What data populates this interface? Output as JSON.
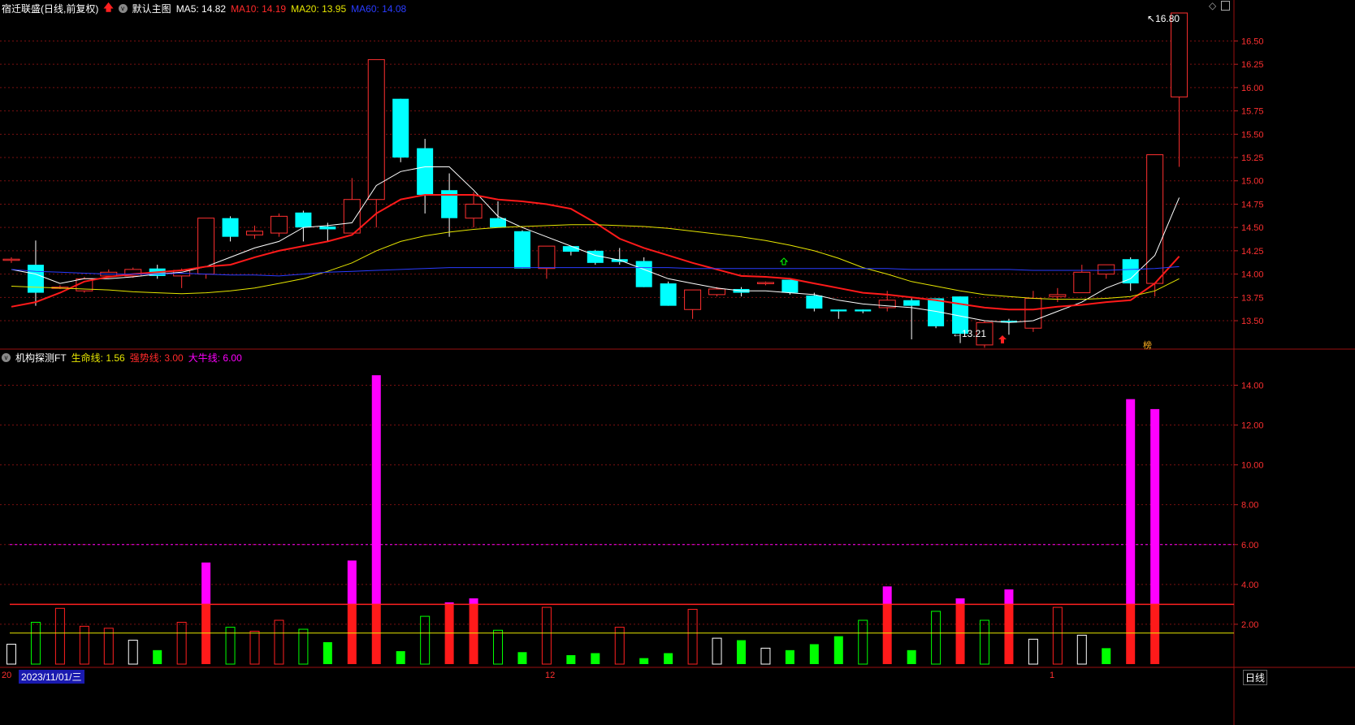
{
  "header": {
    "title": "宿迁联盛(日线,前复权)",
    "template": "默认主图",
    "ma": [
      {
        "label": "MA5: 14.82",
        "color": "#ffffff"
      },
      {
        "label": "MA10: 14.19",
        "color": "#ff2a2a"
      },
      {
        "label": "MA20: 13.95",
        "color": "#e6e600"
      },
      {
        "label": "MA60: 14.08",
        "color": "#2a3cff"
      }
    ]
  },
  "sub_header": {
    "title": "机构探测FT",
    "lines": [
      {
        "label": "生命线: 1.56",
        "color": "#e6e600"
      },
      {
        "label": "强势线: 3.00",
        "color": "#ff2a2a"
      },
      {
        "label": "大牛线: 6.00",
        "color": "#ff00ff"
      }
    ]
  },
  "price_marks": {
    "high": "16.80",
    "low": "13.21",
    "bang": "榜"
  },
  "bottom": {
    "date": "2023/11/01/三",
    "month_left": "20",
    "month_mid": "12",
    "month_right": "1",
    "period": "日线"
  },
  "colors": {
    "up": "#ff3030",
    "down": "#00ffff",
    "bg": "#000000",
    "grid": "#7a1010"
  },
  "chart_data": [
    {
      "type": "candlestick",
      "y_ticks": [
        "16.50",
        "16.25",
        "16.00",
        "15.75",
        "15.50",
        "15.25",
        "15.00",
        "14.75",
        "14.50",
        "14.25",
        "14.00",
        "13.75",
        "13.50"
      ],
      "ylim": [
        13.3,
        16.8
      ],
      "candles": [
        [
          14.16,
          14.16,
          14.18,
          14.12
        ],
        [
          14.1,
          13.8,
          14.36,
          13.66
        ],
        [
          13.86,
          13.86,
          13.88,
          13.84
        ],
        [
          13.82,
          13.95,
          13.97,
          13.8
        ],
        [
          13.98,
          14.02,
          14.05,
          13.96
        ],
        [
          13.98,
          14.05,
          14.07,
          13.96
        ],
        [
          14.06,
          13.98,
          14.1,
          13.95
        ],
        [
          13.98,
          14.04,
          14.06,
          13.85
        ],
        [
          14.0,
          14.6,
          14.6,
          13.95
        ],
        [
          14.6,
          14.4,
          14.62,
          14.35
        ],
        [
          14.42,
          14.46,
          14.52,
          14.38
        ],
        [
          14.44,
          14.62,
          14.65,
          14.4
        ],
        [
          14.66,
          14.5,
          14.68,
          14.35
        ],
        [
          14.51,
          14.48,
          14.55,
          14.35
        ],
        [
          14.44,
          14.8,
          15.03,
          14.44
        ],
        [
          14.8,
          16.3,
          16.3,
          14.5
        ],
        [
          15.88,
          15.25,
          15.88,
          15.2
        ],
        [
          15.35,
          14.85,
          15.45,
          14.65
        ],
        [
          14.9,
          14.6,
          15.08,
          14.4
        ],
        [
          14.6,
          14.75,
          14.88,
          14.5
        ],
        [
          14.6,
          14.5,
          14.78,
          14.5
        ],
        [
          14.46,
          14.06,
          14.47,
          14.06
        ],
        [
          14.06,
          14.3,
          14.3,
          13.95
        ],
        [
          14.3,
          14.24,
          14.3,
          14.2
        ],
        [
          14.25,
          14.12,
          14.26,
          14.1
        ],
        [
          14.16,
          14.13,
          14.28,
          14.1
        ],
        [
          14.14,
          13.86,
          14.18,
          13.86
        ],
        [
          13.9,
          13.66,
          13.92,
          13.66
        ],
        [
          13.62,
          13.83,
          13.83,
          13.52
        ],
        [
          13.78,
          13.84,
          13.86,
          13.76
        ],
        [
          13.84,
          13.8,
          13.86,
          13.76
        ],
        [
          13.9,
          13.91,
          13.92,
          13.88
        ],
        [
          13.94,
          13.8,
          13.94,
          13.78
        ],
        [
          13.77,
          13.63,
          13.8,
          13.6
        ],
        [
          13.62,
          13.6,
          13.62,
          13.52
        ],
        [
          13.62,
          13.6,
          13.62,
          13.58
        ],
        [
          13.64,
          13.72,
          13.82,
          13.6
        ],
        [
          13.72,
          13.66,
          13.74,
          13.3
        ],
        [
          13.74,
          13.44,
          13.74,
          13.42
        ],
        [
          13.76,
          13.36,
          13.76,
          13.26
        ],
        [
          13.24,
          13.48,
          13.5,
          13.21
        ],
        [
          13.5,
          13.48,
          13.52,
          13.35
        ],
        [
          13.42,
          13.74,
          13.82,
          13.38
        ],
        [
          13.76,
          13.78,
          13.85,
          13.7
        ],
        [
          13.8,
          14.02,
          14.1,
          13.8
        ],
        [
          14.0,
          14.1,
          14.1,
          13.95
        ],
        [
          14.16,
          13.9,
          14.18,
          13.82
        ],
        [
          13.9,
          15.28,
          15.28,
          13.76
        ],
        [
          15.9,
          16.8,
          16.8,
          15.15
        ]
      ],
      "ma5": [
        14.05,
        14.0,
        13.9,
        13.95,
        13.95,
        13.97,
        14.0,
        14.02,
        14.08,
        14.18,
        14.28,
        14.35,
        14.5,
        14.52,
        14.55,
        14.95,
        15.1,
        15.15,
        15.15,
        14.9,
        14.62,
        14.5,
        14.4,
        14.3,
        14.2,
        14.15,
        14.05,
        13.95,
        13.9,
        13.85,
        13.82,
        13.82,
        13.8,
        13.78,
        13.72,
        13.68,
        13.66,
        13.64,
        13.6,
        13.55,
        13.5,
        13.48,
        13.5,
        13.6,
        13.7,
        13.85,
        13.95,
        14.2,
        14.82
      ],
      "ma10": [
        13.65,
        13.7,
        13.8,
        13.92,
        13.97,
        14.0,
        14.02,
        14.04,
        14.08,
        14.1,
        14.18,
        14.25,
        14.3,
        14.35,
        14.42,
        14.65,
        14.8,
        14.85,
        14.85,
        14.85,
        14.8,
        14.78,
        14.75,
        14.7,
        14.55,
        14.38,
        14.28,
        14.2,
        14.12,
        14.05,
        13.98,
        13.97,
        13.95,
        13.9,
        13.85,
        13.8,
        13.78,
        13.75,
        13.72,
        13.68,
        13.64,
        13.62,
        13.62,
        13.65,
        13.67,
        13.7,
        13.72,
        13.9,
        14.19
      ],
      "ma20": [
        13.87,
        13.86,
        13.85,
        13.84,
        13.83,
        13.81,
        13.8,
        13.79,
        13.8,
        13.82,
        13.85,
        13.9,
        13.95,
        14.03,
        14.12,
        14.25,
        14.35,
        14.41,
        14.45,
        14.48,
        14.5,
        14.51,
        14.52,
        14.53,
        14.53,
        14.52,
        14.51,
        14.49,
        14.46,
        14.43,
        14.4,
        14.36,
        14.31,
        14.25,
        14.17,
        14.07,
        14.0,
        13.92,
        13.87,
        13.82,
        13.78,
        13.76,
        13.74,
        13.73,
        13.73,
        13.74,
        13.76,
        13.82,
        13.95
      ],
      "ma60": [
        14.05,
        14.03,
        14.02,
        14.01,
        14.0,
        14.0,
        14.0,
        14.01,
        14.0,
        13.99,
        13.99,
        13.98,
        14.0,
        14.02,
        14.03,
        14.04,
        14.05,
        14.06,
        14.07,
        14.07,
        14.07,
        14.07,
        14.07,
        14.07,
        14.07,
        14.07,
        14.07,
        14.07,
        14.06,
        14.06,
        14.06,
        14.06,
        14.06,
        14.06,
        14.06,
        14.06,
        14.06,
        14.05,
        14.05,
        14.05,
        14.05,
        14.05,
        14.04,
        14.04,
        14.04,
        14.04,
        14.05,
        14.06,
        14.08
      ]
    },
    {
      "type": "bar",
      "y_ticks": [
        "14.00",
        "12.00",
        "10.00",
        "8.00",
        "6.00",
        "4.00",
        "2.00"
      ],
      "ylim": [
        0,
        15.2
      ],
      "lines": {
        "生命线": 1.56,
        "强势线": 3.0,
        "大牛线": 6.0
      },
      "values": [
        1.0,
        2.1,
        2.8,
        1.9,
        1.8,
        1.2,
        0.7,
        2.1,
        5.1,
        1.85,
        1.65,
        2.2,
        1.75,
        1.1,
        5.2,
        14.5,
        0.65,
        2.4,
        3.1,
        3.3,
        1.7,
        0.6,
        2.85,
        0.45,
        0.55,
        1.85,
        0.3,
        0.55,
        2.75,
        1.3,
        1.2,
        0.8,
        0.7,
        1.0,
        1.4,
        2.2,
        3.9,
        0.7,
        2.65,
        3.3,
        2.2,
        3.75,
        1.25,
        2.85,
        1.45,
        0.8,
        13.3,
        12.8
      ],
      "styles": [
        "w",
        "go",
        "ro",
        "ro",
        "ro",
        "w",
        "g",
        "ro",
        "rm",
        "go",
        "ro",
        "ro",
        "go",
        "g",
        "rm",
        "rm",
        "g",
        "go",
        "rf",
        "rf",
        "go",
        "g",
        "ro",
        "g",
        "g",
        "ro",
        "g",
        "g",
        "ro",
        "w",
        "g",
        "w",
        "g",
        "g",
        "g",
        "go",
        "rm",
        "g",
        "go",
        "rf",
        "go",
        "rm",
        "w",
        "ro",
        "w",
        "g",
        "rm",
        "rm"
      ]
    }
  ]
}
